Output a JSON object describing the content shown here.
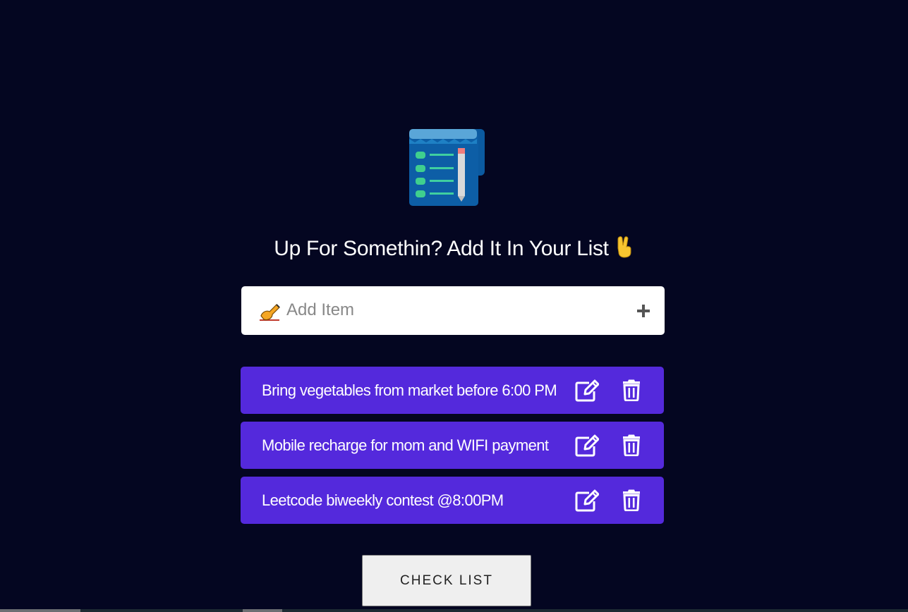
{
  "header": {
    "logo_icon": "shopping-list-icon",
    "heading": "Up For Somethin? Add It In Your List",
    "heading_emoji": "✌️"
  },
  "add_item": {
    "icon": "writing-hand-icon",
    "placeholder": "Add Item",
    "value": "",
    "add_icon": "plus-icon"
  },
  "items": [
    {
      "text": "Bring vegetables from market before 6:00 PM",
      "edit_icon": "edit-icon",
      "delete_icon": "trash-icon"
    },
    {
      "text": "Mobile recharge for mom and WIFI payment",
      "edit_icon": "edit-icon",
      "delete_icon": "trash-icon"
    },
    {
      "text": "Leetcode biweekly contest @8:00PM",
      "edit_icon": "edit-icon",
      "delete_icon": "trash-icon"
    }
  ],
  "check_list_button": "CHECK LIST",
  "colors": {
    "background": "#040621",
    "item_background": "#5429dc",
    "input_background": "#ffffff",
    "button_background": "#efefef"
  }
}
